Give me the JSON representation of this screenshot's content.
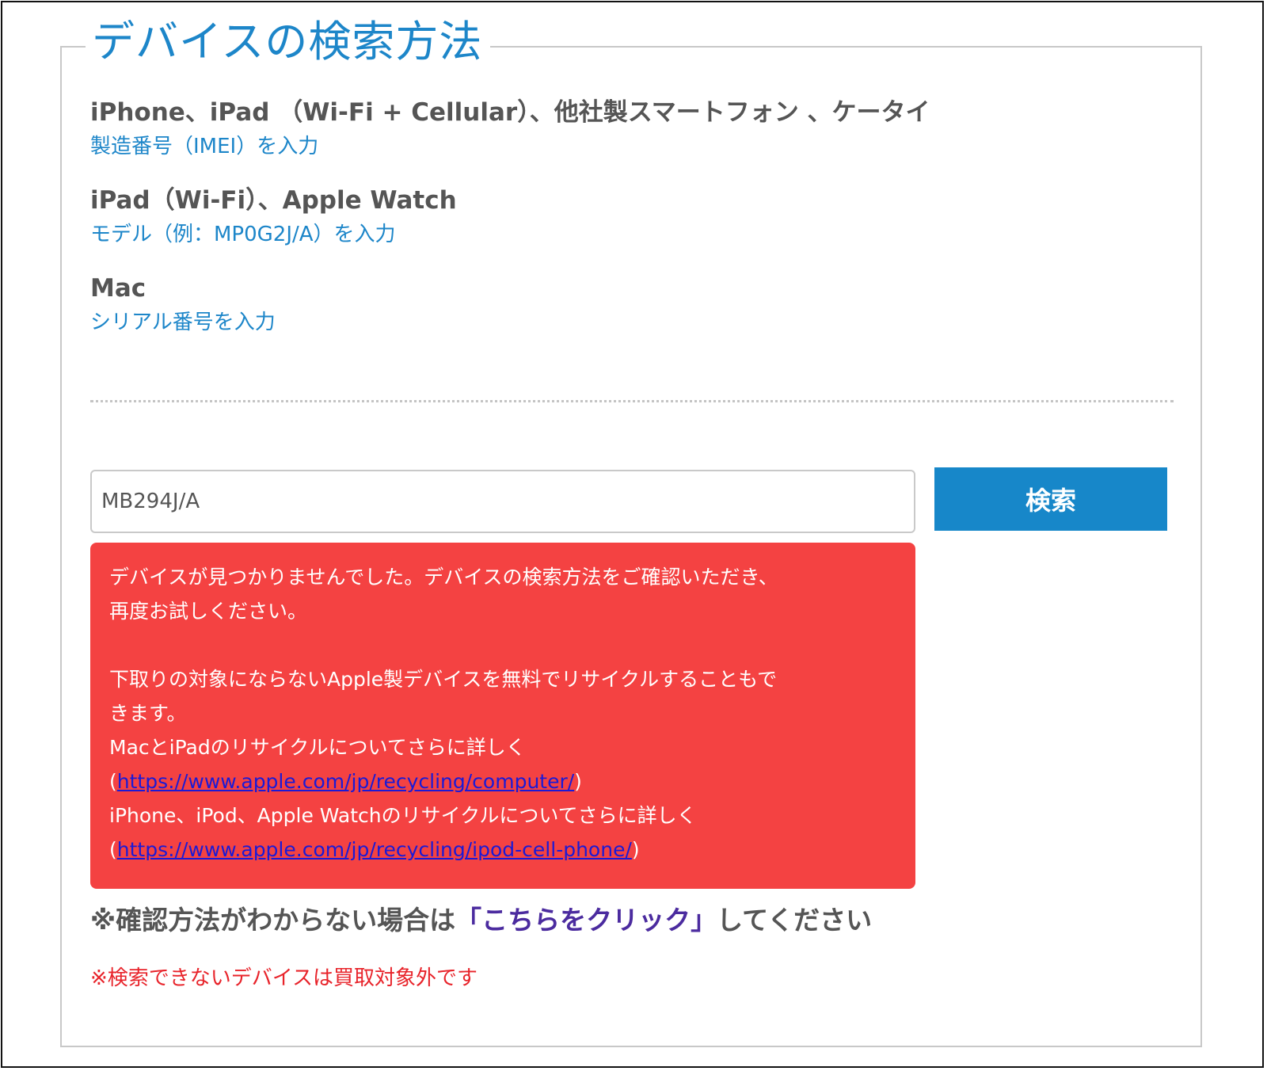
{
  "section": {
    "title": "デバイスの検索方法"
  },
  "device_groups": [
    {
      "title": "iPhone、iPad （Wi-Fi + Cellular）、他社製スマートフォン 、ケータイ",
      "hint": "製造番号（IMEI）を入力"
    },
    {
      "title": "iPad（Wi-Fi）、Apple Watch",
      "hint": "モデル（例：MP0G2J/A）を入力"
    },
    {
      "title": "Mac",
      "hint": "シリアル番号を入力"
    }
  ],
  "search": {
    "input_value": "MB294J/A",
    "button_label": "検索"
  },
  "error": {
    "line1": "デバイスが見つかりませんでした。デバイスの検索方法をご確認いただき、",
    "line2": "再度お試しください。",
    "line3": "下取りの対象にならないApple製デバイスを無料でリサイクルすることもで",
    "line4": "きます。",
    "mac_text": "MacとiPadのリサイクルについてさらに詳しく",
    "paren_open": "(",
    "paren_close": ")",
    "mac_url": "https://www.apple.com/jp/recycling/computer/",
    "iphone_text": "iPhone、iPod、Apple Watchのリサイクルについてさらに詳しく",
    "iphone_url": "https://www.apple.com/jp/recycling/ipod-cell-phone/"
  },
  "help": {
    "prefix": "※確認方法がわからない場合は",
    "link": "「こちらをクリック」",
    "suffix": "してください"
  },
  "note": "※検索できないデバイスは買取対象外です",
  "colors": {
    "accent_blue": "#1d86c9",
    "button_blue": "#1787c9",
    "error_red": "#f44242",
    "link_blue": "#1b1ad6",
    "help_link_purple": "#4b2b9f",
    "note_red": "#e8232a"
  }
}
